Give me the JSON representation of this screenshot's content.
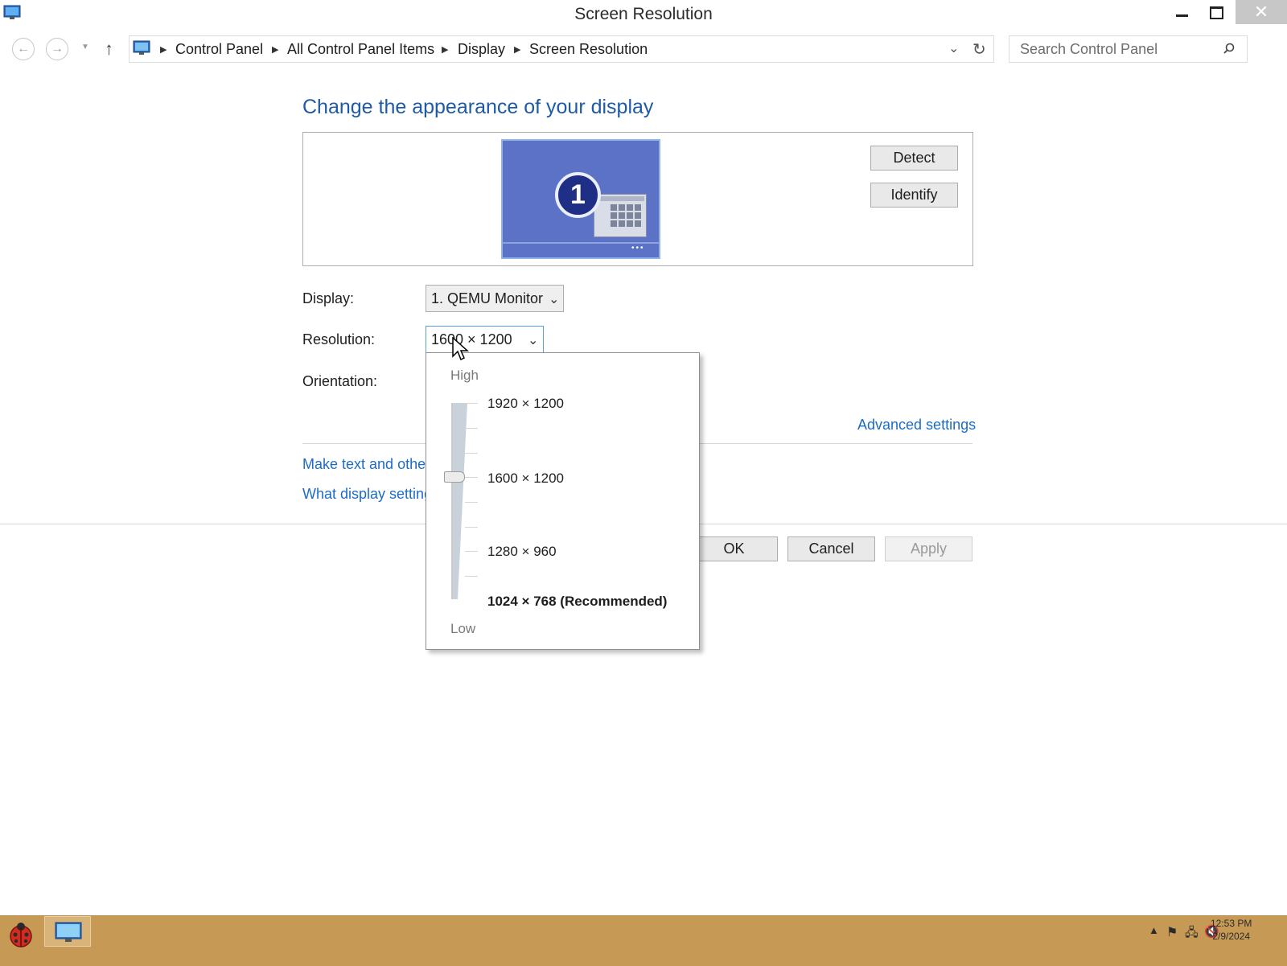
{
  "window": {
    "title": "Screen Resolution"
  },
  "breadcrumb": [
    "Control Panel",
    "All Control Panel Items",
    "Display",
    "Screen Resolution"
  ],
  "search": {
    "placeholder": "Search Control Panel"
  },
  "main": {
    "heading": "Change the appearance of your display",
    "monitor_number": "1",
    "detect_label": "Detect",
    "identify_label": "Identify",
    "display_label": "Display:",
    "display_value": "1. QEMU Monitor",
    "resolution_label": "Resolution:",
    "resolution_value": "1600 × 1200",
    "orientation_label": "Orientation:",
    "advanced_link": "Advanced settings",
    "link_text_size": "Make text and other",
    "link_what_settings": "What display setting",
    "ok_label": "OK",
    "cancel_label": "Cancel",
    "apply_label": "Apply"
  },
  "resolution_popup": {
    "high_label": "High",
    "low_label": "Low",
    "options": [
      "1920 × 1200",
      "1600 × 1200",
      "1280 × 960",
      "1024 × 768 (Recommended)"
    ],
    "selected": "1600 × 1200"
  },
  "taskbar": {
    "time": "12:53 PM",
    "date": "2/9/2024"
  },
  "colors": {
    "link": "#1e6bc8",
    "heading": "#1e5aa8",
    "taskbar": "#c69a55",
    "monitor": "#5b72c6"
  }
}
